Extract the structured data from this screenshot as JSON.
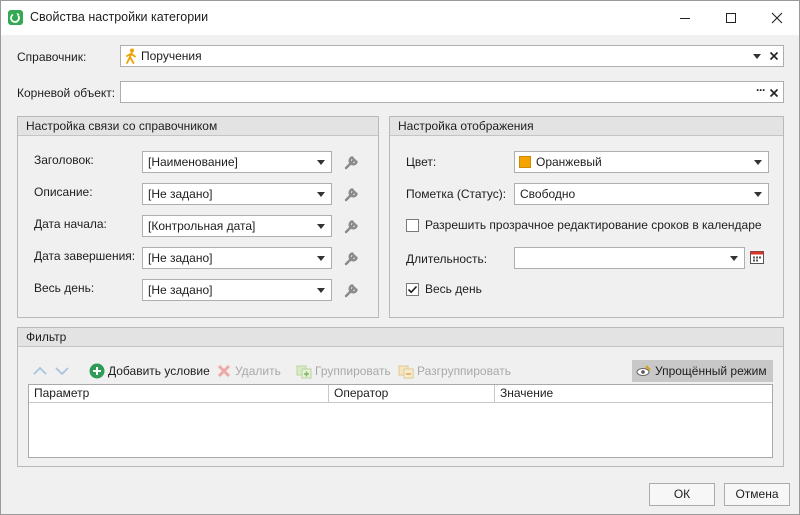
{
  "window": {
    "title": "Свойства настройки категории"
  },
  "fields": {
    "reference_label": "Справочник:",
    "reference_value": "Поручения",
    "root_label": "Корневой объект:",
    "root_value": "",
    "ellipsis": "···"
  },
  "link_group": {
    "title": "Настройка связи со справочником",
    "rows": [
      {
        "label": "Заголовок:",
        "value": "[Наименование]"
      },
      {
        "label": "Описание:",
        "value": "[Не задано]"
      },
      {
        "label": "Дата начала:",
        "value": "[Контрольная дата]"
      },
      {
        "label": "Дата завершения:",
        "value": "[Не задано]"
      },
      {
        "label": "Весь день:",
        "value": "[Не задано]"
      }
    ]
  },
  "display_group": {
    "title": "Настройка отображения",
    "color_label": "Цвет:",
    "color_value": "Оранжевый",
    "color_swatch": "#f5a300",
    "status_label": "Пометка (Статус):",
    "status_value": "Свободно",
    "transparent_edit_label": "Разрешить прозрачное редактирование сроков в календаре",
    "transparent_edit_checked": false,
    "duration_label": "Длительность:",
    "duration_value": "",
    "allday_label": "Весь день",
    "allday_checked": true
  },
  "filter_group": {
    "title": "Фильтр",
    "toolbar": {
      "add_condition": "Добавить условие",
      "delete": "Удалить",
      "group": "Группировать",
      "ungroup": "Разгруппировать",
      "simple_mode": "Упрощённый режим"
    },
    "columns": [
      "Параметр",
      "Оператор",
      "Значение"
    ]
  },
  "buttons": {
    "ok": "ОК",
    "cancel": "Отмена"
  }
}
